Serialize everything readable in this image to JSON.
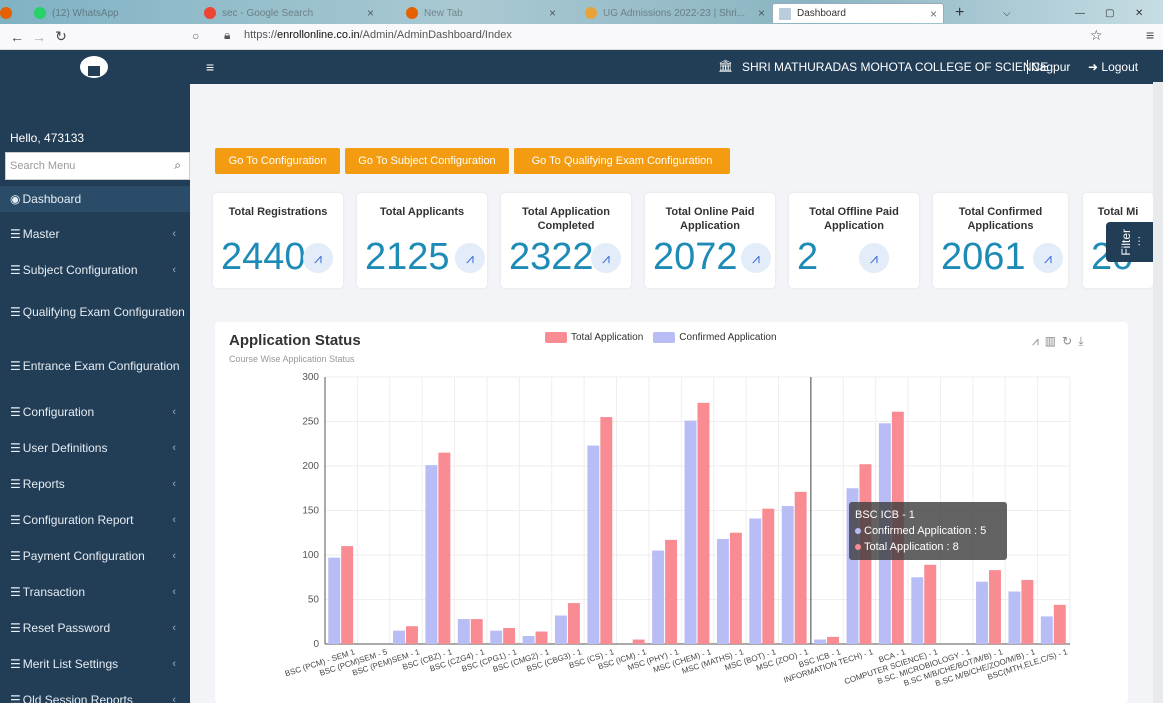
{
  "browser": {
    "tabs": [
      {
        "label": "(12) WhatsApp",
        "active": false
      },
      {
        "label": "sec - Google Search",
        "active": false
      },
      {
        "label": "New Tab",
        "active": false
      },
      {
        "label": "UG Admissions 2022-23 | Shri...",
        "active": false
      },
      {
        "label": "Dashboard",
        "active": true
      }
    ],
    "url_prefix": "https://",
    "url_domain": "enrollonline.co.in",
    "url_path": "/Admin/AdminDashboard/Index"
  },
  "sidebar": {
    "greeting": "Hello, 473133",
    "search_placeholder": "Search Menu",
    "items": [
      {
        "label": "Dashboard",
        "active": true
      },
      {
        "label": "Master"
      },
      {
        "label": "Subject Configuration"
      },
      {
        "label": "Qualifying Exam Configuration"
      },
      {
        "label": "Entrance Exam Configuration"
      },
      {
        "label": "Configuration"
      },
      {
        "label": "User Definitions"
      },
      {
        "label": "Reports"
      },
      {
        "label": "Configuration Report"
      },
      {
        "label": "Payment Configuration"
      },
      {
        "label": "Transaction"
      },
      {
        "label": "Reset Password"
      },
      {
        "label": "Merit List Settings"
      },
      {
        "label": "Old Session Reports"
      }
    ]
  },
  "topbar": {
    "college": "SHRI MATHURADAS MOHOTA COLLEGE OF SCIENCE",
    "city": "Nagpur",
    "logout": "Logout"
  },
  "buttons": [
    "Go To Configuration",
    "Go To Subject Configuration",
    "Go To Qualifying Exam Configuration"
  ],
  "cards": [
    {
      "title": "Total Registrations",
      "value": "2440"
    },
    {
      "title": "Total Applicants",
      "value": "2125"
    },
    {
      "title": "Total Application Completed",
      "value": "2322"
    },
    {
      "title": "Total Online Paid Application",
      "value": "2072"
    },
    {
      "title": "Total Offline Paid Application",
      "value": "2"
    },
    {
      "title": "Total Confirmed Applications",
      "value": "2061"
    },
    {
      "title": "Total Mi",
      "value": "20"
    }
  ],
  "filter_label": "Filter",
  "chart_data": {
    "type": "bar",
    "title": "Application Status",
    "subtitle": "Course  Wise Application Status",
    "ylim": [
      0,
      300
    ],
    "yticks": [
      0,
      50,
      100,
      150,
      200,
      250,
      300
    ],
    "categories": [
      "BSC (PCM) - SEM 1",
      "BSC (PCM)SEM - 5",
      "BSC (PEM)SEM - 1",
      "BSC (CBZ) - 1",
      "BSC (CZG4) - 1",
      "BSC (CPG1) - 1",
      "BSC (CMG2) - 1",
      "BSC (CBG3) - 1",
      "BSC (CS) - 1",
      "BSC (ICM) - 1",
      "MSC (PHY) - 1",
      "MSC (CHEM) - 1",
      "MSC (MATHS) - 1",
      "MSC (BOT) - 1",
      "MSC (ZOO) - 1",
      "BSC ICB - 1",
      "INFORMATION TECH) - 1",
      "BCA - 1",
      "COMPUTER SCIENCE) - 1",
      "B.SC. MICROBIOLOGY - 1",
      "B.SC M/B/CHE/BOT/M/B) - 1",
      "B.SC M/B/CHE/ZOO/M/B) - 1",
      "BSC(MTH,ELE,C/S) - 1"
    ],
    "series": [
      {
        "name": "Confirmed Application",
        "color": "#b9bdf5",
        "values": [
          97,
          0,
          15,
          201,
          28,
          15,
          9,
          32,
          223,
          0,
          105,
          251,
          118,
          141,
          155,
          5,
          175,
          248,
          75,
          0,
          70,
          59,
          31
        ]
      },
      {
        "name": "Total Application",
        "color": "#f98c93",
        "values": [
          110,
          0,
          20,
          215,
          28,
          18,
          14,
          46,
          255,
          5,
          117,
          271,
          125,
          152,
          171,
          8,
          202,
          261,
          89,
          0,
          83,
          72,
          44
        ]
      }
    ],
    "legend": "top-center",
    "tooltip": {
      "title": "BSC ICB - 1",
      "lines": [
        "Confirmed Application : 5",
        "Total Application : 8"
      ]
    }
  }
}
